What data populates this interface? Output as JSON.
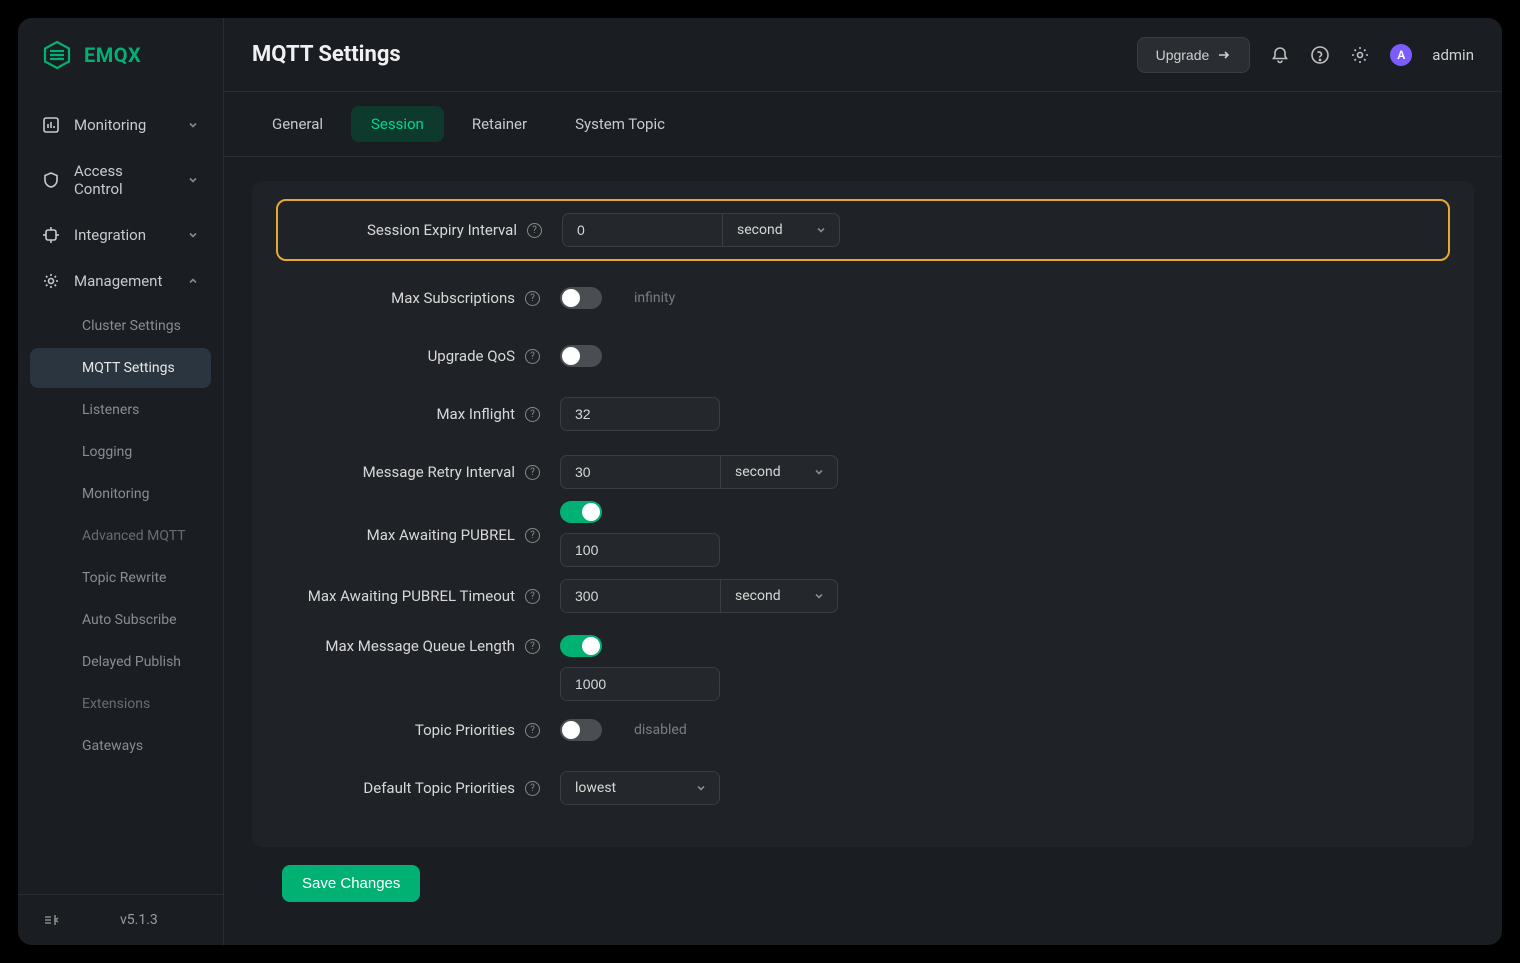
{
  "brand": "EMQX",
  "header": {
    "title": "MQTT Settings",
    "upgrade": "Upgrade",
    "user": "admin",
    "avatar_letter": "A"
  },
  "sidebar": {
    "items": [
      {
        "label": "Monitoring",
        "icon": "monitoring"
      },
      {
        "label": "Access Control",
        "icon": "shield"
      },
      {
        "label": "Integration",
        "icon": "integration"
      },
      {
        "label": "Management",
        "icon": "management"
      }
    ],
    "management_children": [
      {
        "label": "Cluster Settings",
        "kind": "link"
      },
      {
        "label": "MQTT Settings",
        "kind": "link",
        "active": true
      },
      {
        "label": "Listeners",
        "kind": "link"
      },
      {
        "label": "Logging",
        "kind": "link"
      },
      {
        "label": "Monitoring",
        "kind": "link"
      },
      {
        "label": "Advanced MQTT",
        "kind": "section"
      },
      {
        "label": "Topic Rewrite",
        "kind": "link"
      },
      {
        "label": "Auto Subscribe",
        "kind": "link"
      },
      {
        "label": "Delayed Publish",
        "kind": "link"
      },
      {
        "label": "Extensions",
        "kind": "section"
      },
      {
        "label": "Gateways",
        "kind": "link"
      }
    ],
    "version": "v5.1.3"
  },
  "tabs": [
    "General",
    "Session",
    "Retainer",
    "System Topic"
  ],
  "active_tab": "Session",
  "form": {
    "session_expiry": {
      "label": "Session Expiry Interval",
      "value": "0",
      "unit": "second"
    },
    "max_subscriptions": {
      "label": "Max Subscriptions",
      "enabled": false,
      "hint": "infinity"
    },
    "upgrade_qos": {
      "label": "Upgrade QoS",
      "enabled": false
    },
    "max_inflight": {
      "label": "Max Inflight",
      "value": "32"
    },
    "retry_interval": {
      "label": "Message Retry Interval",
      "value": "30",
      "unit": "second"
    },
    "max_awaiting_pubrel": {
      "label": "Max Awaiting PUBREL",
      "enabled": true,
      "value": "100"
    },
    "pubrel_timeout": {
      "label": "Max Awaiting PUBREL Timeout",
      "value": "300",
      "unit": "second"
    },
    "max_queue": {
      "label": "Max Message Queue Length",
      "enabled": true,
      "value": "1000"
    },
    "topic_priorities": {
      "label": "Topic Priorities",
      "enabled": false,
      "hint": "disabled"
    },
    "default_topic_priorities": {
      "label": "Default Topic Priorities",
      "value": "lowest"
    }
  },
  "buttons": {
    "save": "Save Changes"
  }
}
